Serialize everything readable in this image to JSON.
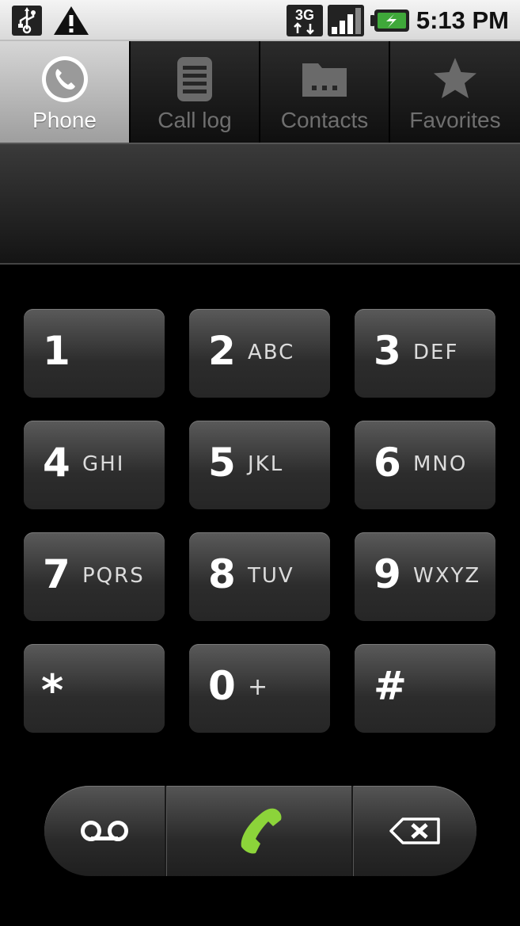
{
  "status_bar": {
    "network": "3G",
    "time": "5:13 PM"
  },
  "tabs": [
    {
      "label": "Phone",
      "icon": "phone-icon",
      "active": true
    },
    {
      "label": "Call log",
      "icon": "call-log-icon",
      "active": false
    },
    {
      "label": "Contacts",
      "icon": "contacts-icon",
      "active": false
    },
    {
      "label": "Favorites",
      "icon": "star-icon",
      "active": false
    }
  ],
  "dialed_number": "",
  "keypad": [
    {
      "digit": "1",
      "letters": ""
    },
    {
      "digit": "2",
      "letters": "ABC"
    },
    {
      "digit": "3",
      "letters": "DEF"
    },
    {
      "digit": "4",
      "letters": "GHI"
    },
    {
      "digit": "5",
      "letters": "JKL"
    },
    {
      "digit": "6",
      "letters": "MNO"
    },
    {
      "digit": "7",
      "letters": "PQRS"
    },
    {
      "digit": "8",
      "letters": "TUV"
    },
    {
      "digit": "9",
      "letters": "WXYZ"
    },
    {
      "digit": "*",
      "letters": ""
    },
    {
      "digit": "0",
      "letters": "+"
    },
    {
      "digit": "#",
      "letters": ""
    }
  ],
  "bottom_bar": {
    "left_icon": "voicemail-icon",
    "center_icon": "call-icon",
    "right_icon": "backspace-icon",
    "call_color": "#8cd43a"
  }
}
